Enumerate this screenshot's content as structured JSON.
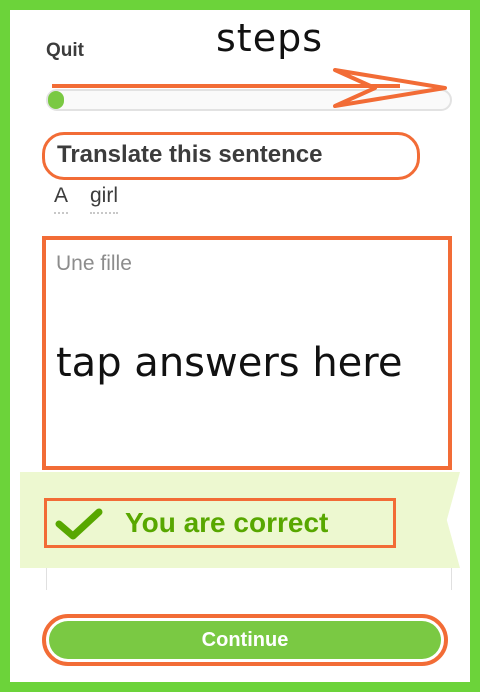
{
  "header": {
    "quit_label": "Quit",
    "steps_annotation": "steps"
  },
  "progress": {
    "fraction": 0.04
  },
  "exercise": {
    "prompt": "Translate this sentence",
    "source_words": [
      "A",
      "girl"
    ]
  },
  "answer": {
    "value": "Une fille",
    "annotation": "tap answers here"
  },
  "result": {
    "message": "You are correct",
    "icon": "check-icon"
  },
  "footer": {
    "continue_label": "Continue"
  },
  "colors": {
    "frame": "#6cd33a",
    "annotation": "#f26c36",
    "primary_green": "#7ac943",
    "correct_text": "#58a700",
    "correct_banner": "#edf8d0"
  }
}
